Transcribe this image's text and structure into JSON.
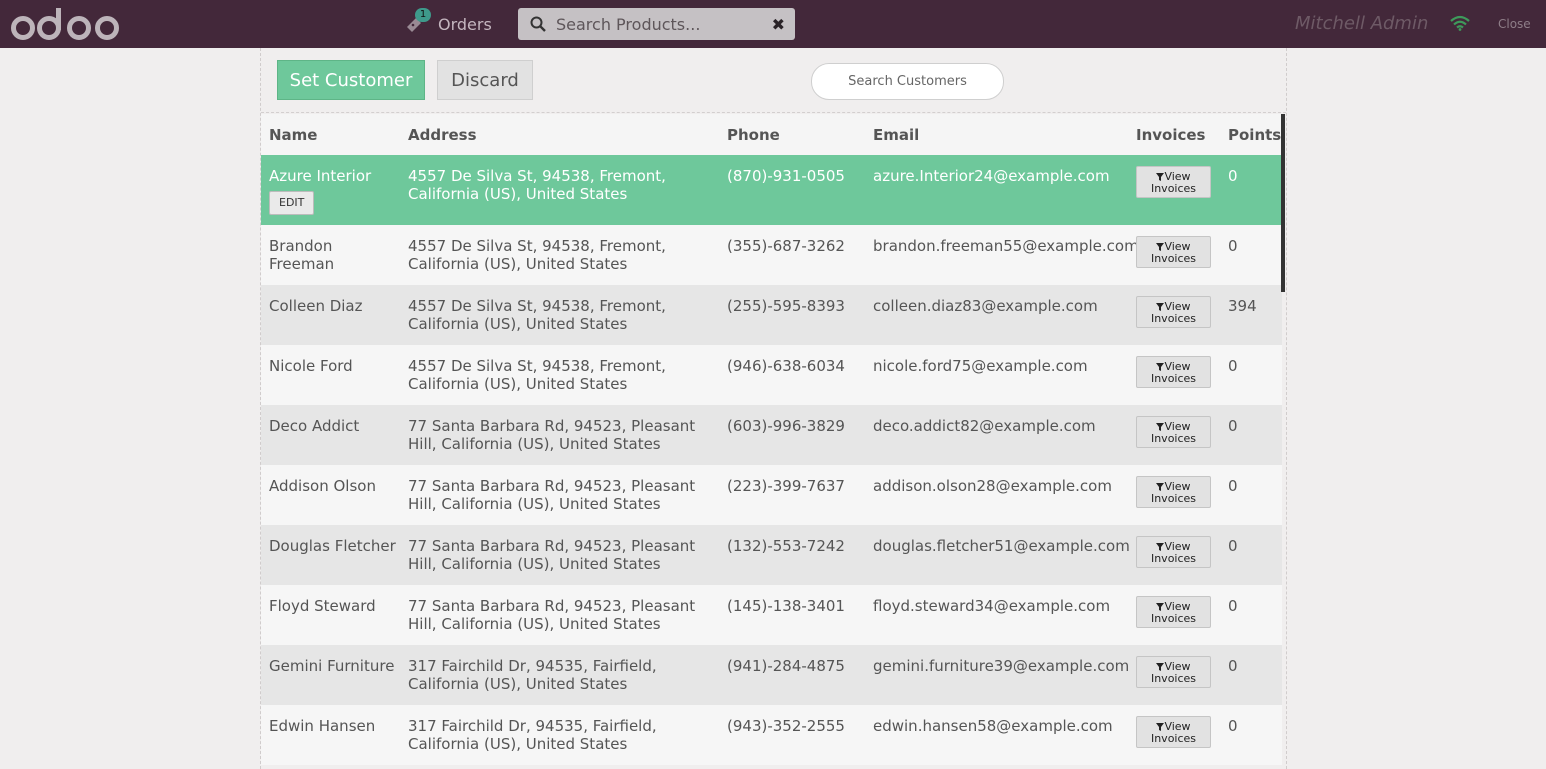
{
  "header": {
    "logo_text": "odoo",
    "orders_label": "Orders",
    "orders_count": "1",
    "search_placeholder": "Search Products...",
    "user_name": "Mitchell Admin",
    "close_label": "Close"
  },
  "toolbar": {
    "set_customer_label": "Set Customer",
    "discard_label": "Discard",
    "search_customers_placeholder": "Search Customers"
  },
  "table": {
    "columns": [
      "Name",
      "Address",
      "Phone",
      "Email",
      "Invoices",
      "Points"
    ],
    "view_invoices_line1": "View",
    "view_invoices_line2": "Invoices",
    "edit_label": "EDIT",
    "rows": [
      {
        "name": "Azure Interior",
        "address": "4557 De Silva St, 94538, Fremont, California (US), United States",
        "phone": "(870)-931-0505",
        "email": "azure.Interior24@example.com",
        "points": "0"
      },
      {
        "name": "Brandon Freeman",
        "address": "4557 De Silva St, 94538, Fremont, California (US), United States",
        "phone": "(355)-687-3262",
        "email": "brandon.freeman55@example.com",
        "points": "0"
      },
      {
        "name": "Colleen Diaz",
        "address": "4557 De Silva St, 94538, Fremont, California (US), United States",
        "phone": "(255)-595-8393",
        "email": "colleen.diaz83@example.com",
        "points": "394"
      },
      {
        "name": "Nicole Ford",
        "address": "4557 De Silva St, 94538, Fremont, California (US), United States",
        "phone": "(946)-638-6034",
        "email": "nicole.ford75@example.com",
        "points": "0"
      },
      {
        "name": "Deco Addict",
        "address": "77 Santa Barbara Rd, 94523, Pleasant Hill, California (US), United States",
        "phone": "(603)-996-3829",
        "email": "deco.addict82@example.com",
        "points": "0"
      },
      {
        "name": "Addison Olson",
        "address": "77 Santa Barbara Rd, 94523, Pleasant Hill, California (US), United States",
        "phone": "(223)-399-7637",
        "email": "addison.olson28@example.com",
        "points": "0"
      },
      {
        "name": "Douglas Fletcher",
        "address": "77 Santa Barbara Rd, 94523, Pleasant Hill, California (US), United States",
        "phone": "(132)-553-7242",
        "email": "douglas.fletcher51@example.com",
        "points": "0"
      },
      {
        "name": "Floyd Steward",
        "address": "77 Santa Barbara Rd, 94523, Pleasant Hill, California (US), United States",
        "phone": "(145)-138-3401",
        "email": "floyd.steward34@example.com",
        "points": "0"
      },
      {
        "name": "Gemini Furniture",
        "address": "317 Fairchild Dr, 94535, Fairfield, California (US), United States",
        "phone": "(941)-284-4875",
        "email": "gemini.furniture39@example.com",
        "points": "0"
      },
      {
        "name": "Edwin Hansen",
        "address": "317 Fairchild Dr, 94535, Fairfield, California (US), United States",
        "phone": "(943)-352-2555",
        "email": "edwin.hansen58@example.com",
        "points": "0"
      }
    ]
  },
  "colors": {
    "topbar": "#43283a",
    "accent_green": "#6ec89b"
  },
  "icons": {
    "orders": "ticket-icon",
    "search": "search-icon",
    "clear": "close-icon",
    "wifi": "wifi-icon",
    "funnel": "funnel-icon"
  }
}
